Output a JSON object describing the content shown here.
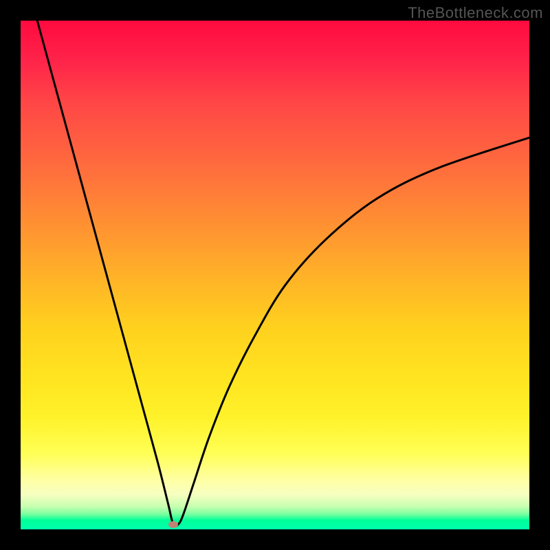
{
  "watermark": "TheBottleneck.com",
  "chart_data": {
    "type": "line",
    "title": "",
    "xlabel": "",
    "ylabel": "",
    "xlim": [
      0,
      100
    ],
    "ylim": [
      0,
      100
    ],
    "grid": false,
    "legend": false,
    "background_gradient": {
      "direction": "vertical",
      "stops": [
        {
          "pos": 0.0,
          "color": "#ff0a3f"
        },
        {
          "pos": 0.28,
          "color": "#ff6a3e"
        },
        {
          "pos": 0.6,
          "color": "#ffd01e"
        },
        {
          "pos": 0.85,
          "color": "#ffff55"
        },
        {
          "pos": 0.97,
          "color": "#7affa0"
        },
        {
          "pos": 1.0,
          "color": "#00ffad"
        }
      ]
    },
    "series": [
      {
        "name": "bottleneck-curve",
        "color": "#000000",
        "x": [
          0,
          3,
          6,
          9,
          12,
          15,
          18,
          21,
          24,
          27,
          29,
          30,
          31,
          32,
          34,
          37,
          41,
          46,
          52,
          60,
          70,
          82,
          100
        ],
        "y": [
          112,
          101,
          90,
          79,
          68,
          57,
          46,
          35,
          24,
          13,
          5,
          1,
          1,
          3,
          9,
          18,
          28,
          38,
          48,
          57,
          65,
          71,
          77
        ]
      }
    ],
    "marker": {
      "name": "target-point",
      "x": 30,
      "y": 1,
      "color": "#c08275"
    }
  },
  "colors": {
    "watermark": "#555555",
    "frame_bg": "#000000",
    "curve": "#000000",
    "marker": "#c08275"
  }
}
